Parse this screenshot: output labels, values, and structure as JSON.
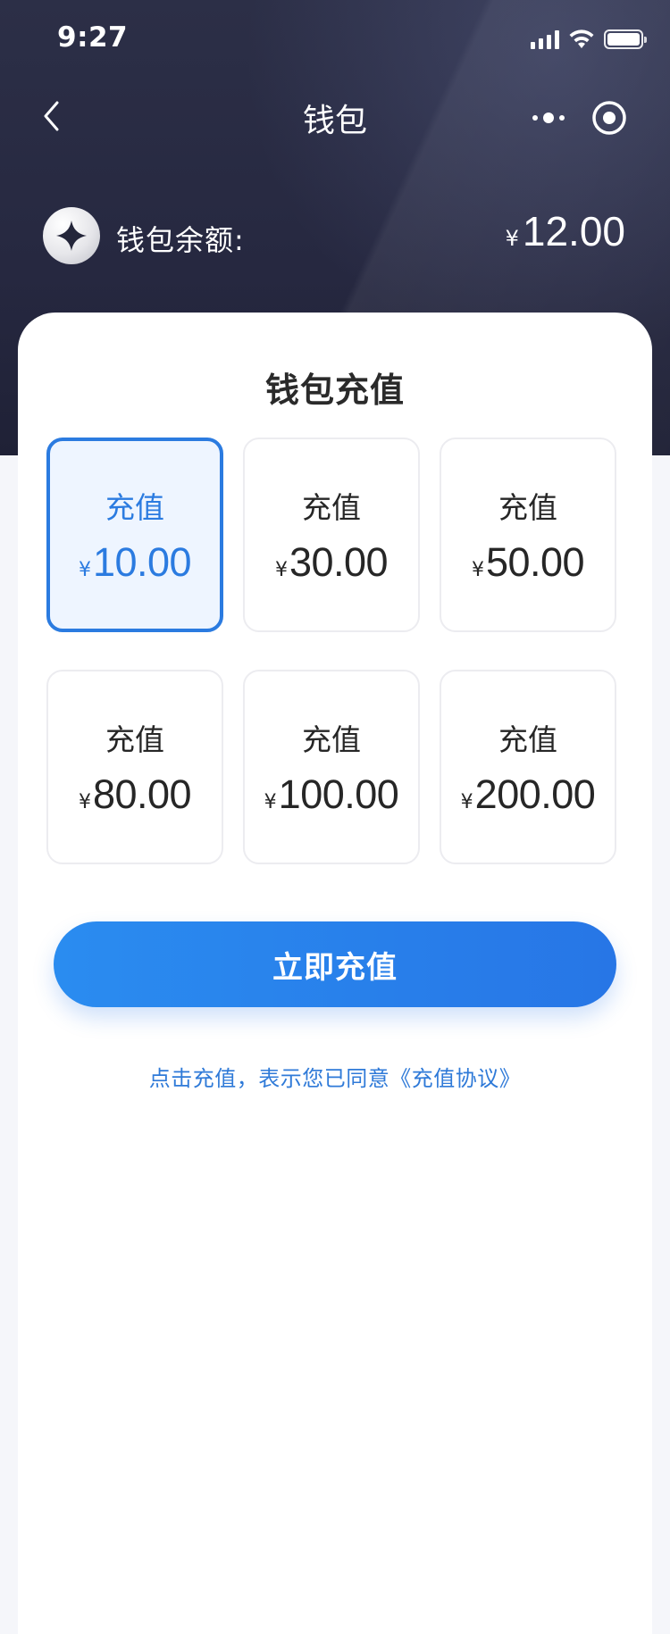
{
  "status_bar": {
    "time": "9:27",
    "icons": [
      "cellular-signal-icon",
      "wifi-icon",
      "battery-icon"
    ]
  },
  "nav": {
    "title": "钱包",
    "back_icon": "chevron-left-icon",
    "more_icon": "more-dots-icon",
    "close_icon": "target-circle-icon"
  },
  "balance": {
    "logo_icon": "diamond-star-icon",
    "label": "钱包余额:",
    "currency": "¥",
    "amount": "12.00"
  },
  "recharge": {
    "title": "钱包充值",
    "options": [
      {
        "label": "充值",
        "currency": "¥",
        "amount": "10.00",
        "selected": true
      },
      {
        "label": "充值",
        "currency": "¥",
        "amount": "30.00",
        "selected": false
      },
      {
        "label": "充值",
        "currency": "¥",
        "amount": "50.00",
        "selected": false
      },
      {
        "label": "充值",
        "currency": "¥",
        "amount": "80.00",
        "selected": false
      },
      {
        "label": "充值",
        "currency": "¥",
        "amount": "100.00",
        "selected": false
      },
      {
        "label": "充值",
        "currency": "¥",
        "amount": "200.00",
        "selected": false
      }
    ],
    "button_label": "立即充值",
    "agreement_prefix": "点击充值，表示您已同意",
    "agreement_link": "《充值协议》"
  },
  "colors": {
    "header_dark": "#262840",
    "accent_blue": "#2b7be0",
    "selected_bg": "#eef5ff"
  }
}
